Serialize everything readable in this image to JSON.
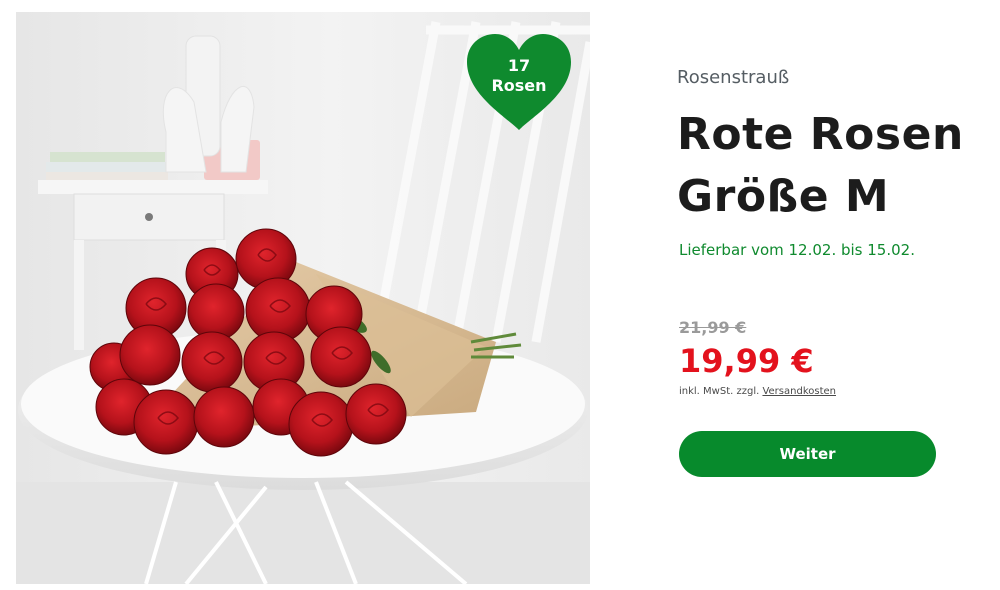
{
  "product": {
    "image_alt": "Strauß roter Rosen auf einem weißen Tisch",
    "badge": {
      "count": "17",
      "unit": "Rosen",
      "color": "#0f8a2e"
    },
    "category": "Rosenstrauß",
    "title_line1": "Rote Rosen",
    "title_line2": "Größe M",
    "delivery": "Lieferbar vom 12.02. bis 15.02.",
    "old_price": "21,99 €",
    "price": "19,99 €",
    "tax_note_prefix": "inkl. MwSt. zzgl.",
    "shipping_link": "Versandkosten",
    "cta_label": "Weiter"
  },
  "colors": {
    "accent_green": "#078a2c",
    "price_red": "#e3121d",
    "strike_gray": "#9a9a9a"
  }
}
